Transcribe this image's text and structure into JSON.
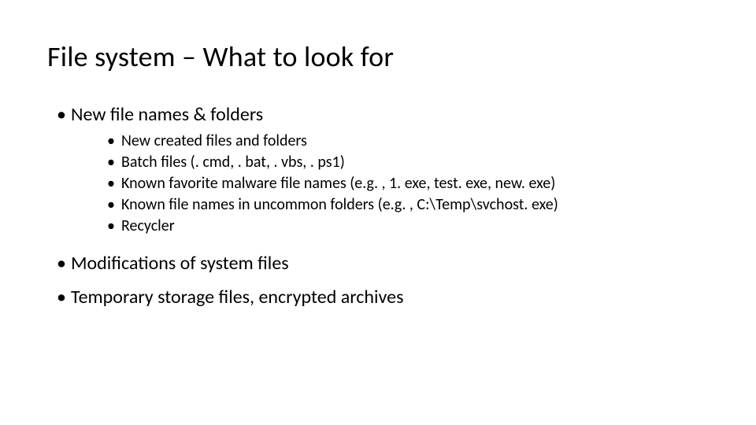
{
  "title": "File system – What to look for",
  "bullets": [
    {
      "text": "New file names & folders",
      "children": [
        "New created files and folders",
        "Batch files (. cmd, . bat, . vbs, . ps1)",
        "Known favorite malware file names (e.g. , 1. exe, test. exe, new. exe)",
        "Known file names in uncommon folders (e.g. , C:\\Temp\\svchost. exe)",
        "Recycler"
      ]
    },
    {
      "text": "Modifications of system files",
      "children": []
    },
    {
      "text": "Temporary storage files, encrypted archives",
      "children": []
    }
  ]
}
